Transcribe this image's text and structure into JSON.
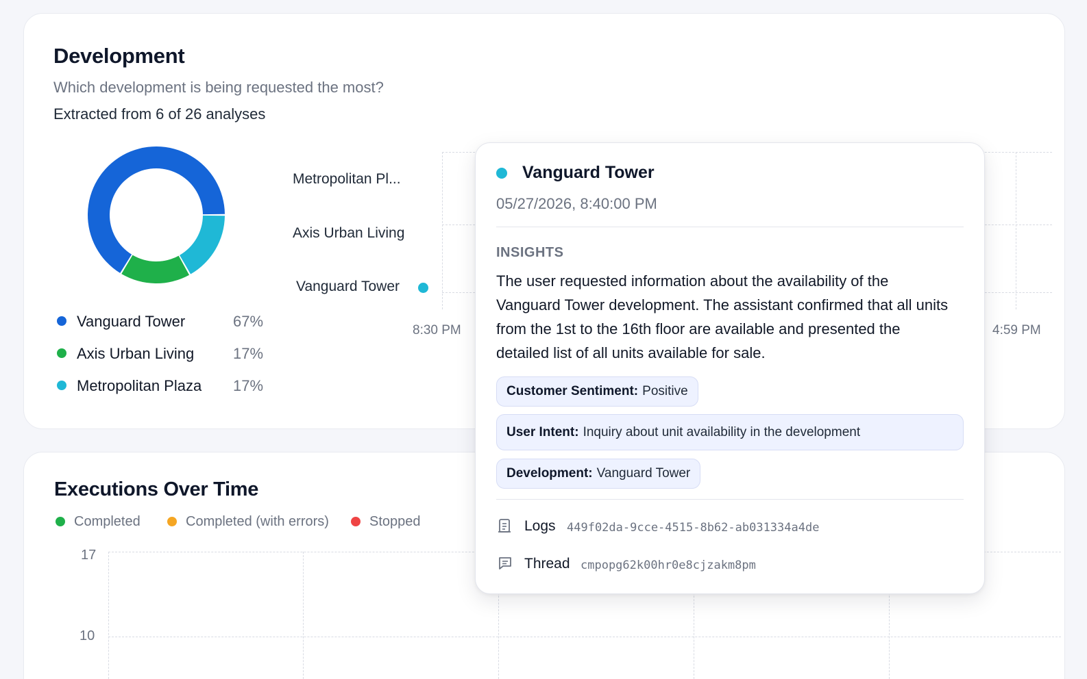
{
  "development": {
    "title": "Development",
    "subtitle": "Which development is being requested the most?",
    "extracted": "Extracted from 6 of 26 analyses",
    "legend": [
      {
        "name": "Vanguard Tower",
        "pct": "67%",
        "color": "#1565d8"
      },
      {
        "name": "Axis Urban Living",
        "pct": "17%",
        "color": "#1fb04a"
      },
      {
        "name": "Metropolitan Plaza",
        "pct": "17%",
        "color": "#1fb8d6"
      }
    ],
    "timeline_labels": [
      "Metropolitan Pl...",
      "Axis Urban Living",
      "Vanguard Tower"
    ],
    "x_ticks": [
      "8:30 PM",
      "4:59 PM"
    ]
  },
  "chart_data": {
    "type": "pie",
    "categories": [
      "Vanguard Tower",
      "Axis Urban Living",
      "Metropolitan Plaza"
    ],
    "values": [
      67,
      17,
      17
    ],
    "colors": [
      "#1565d8",
      "#1fb04a",
      "#1fb8d6"
    ]
  },
  "tooltip": {
    "title": "Vanguard Tower",
    "dot_color": "#1fb8d6",
    "date": "05/27/2026, 8:40:00 PM",
    "section": "INSIGHTS",
    "insight": "The user requested information about the availability of the Vanguard Tower development. The assistant confirmed that all units from the 1st to the 16th floor are available and presented the detailed list of all units available for sale.",
    "chips": [
      {
        "label": "Customer Sentiment:",
        "value": "Positive"
      },
      {
        "label": "User Intent:",
        "value": "Inquiry about unit availability in the development"
      },
      {
        "label": "Development:",
        "value": "Vanguard Tower"
      }
    ],
    "logs_label": "Logs",
    "logs_id": "449f02da-9cce-4515-8b62-ab031334a4de",
    "thread_label": "Thread",
    "thread_id": "cmpopg62k00hr0e8cjzakm8pm",
    "logs_icon": "logs-icon",
    "thread_icon": "thread-icon"
  },
  "executions": {
    "title": "Executions Over Time",
    "legend": [
      {
        "name": "Completed",
        "color": "#1fb04a"
      },
      {
        "name": "Completed (with errors)",
        "color": "#f5a623"
      },
      {
        "name": "Stopped",
        "color": "#ef4444"
      }
    ],
    "y_ticks": [
      "17",
      "10"
    ]
  }
}
